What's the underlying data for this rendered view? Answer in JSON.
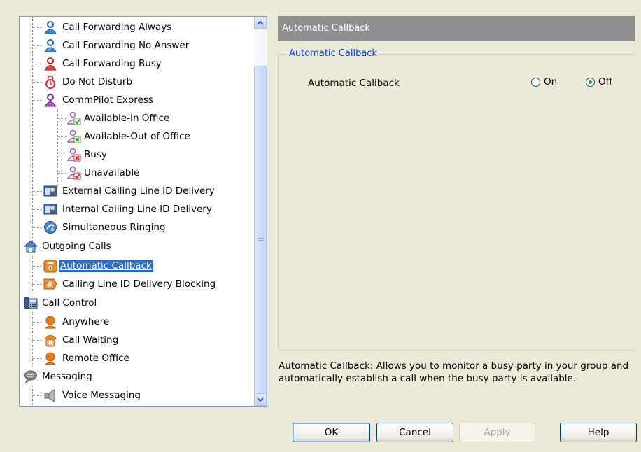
{
  "tree": {
    "items": [
      {
        "label": "Call Forwarding Always",
        "icon": "person-blue-icon"
      },
      {
        "label": "Call Forwarding No Answer",
        "icon": "person-blue-question-icon"
      },
      {
        "label": "Call Forwarding Busy",
        "icon": "person-red-icon"
      },
      {
        "label": "Do Not Disturb",
        "icon": "person-clock-icon"
      },
      {
        "label": "CommPilot Express",
        "icon": "person-purple-icon"
      },
      {
        "label": "Available-In Office",
        "icon": "person-check-icon"
      },
      {
        "label": "Available-Out of Office",
        "icon": "person-cross-green-icon"
      },
      {
        "label": "Busy",
        "icon": "person-cross-red-icon"
      },
      {
        "label": "Unavailable",
        "icon": "person-red-check-icon"
      },
      {
        "label": "External Calling Line ID Delivery",
        "icon": "id-card-icon"
      },
      {
        "label": "Internal Calling Line ID Delivery",
        "icon": "id-card-icon"
      },
      {
        "label": "Simultaneous Ringing",
        "icon": "ringing-globe-icon"
      },
      {
        "label": "Outgoing Calls",
        "icon": "house-icon"
      },
      {
        "label": "Automatic Callback",
        "icon": "phone-callback-icon"
      },
      {
        "label": "Calling Line ID Delivery Blocking",
        "icon": "hash-block-icon"
      },
      {
        "label": "Call Control",
        "icon": "desk-phone-icon"
      },
      {
        "label": "Anywhere",
        "icon": "orange-person-icon"
      },
      {
        "label": "Call Waiting",
        "icon": "phone-waiting-icon"
      },
      {
        "label": "Remote Office",
        "icon": "orange-person-icon"
      },
      {
        "label": "Messaging",
        "icon": "speech-bubble-icon"
      },
      {
        "label": "Voice Messaging",
        "icon": "speaker-icon"
      }
    ]
  },
  "panel": {
    "header": "Automatic Callback",
    "group_title": "Automatic Callback",
    "setting_label": "Automatic Callback",
    "option_on": "On",
    "option_off": "Off",
    "selected": "Off",
    "description": "Automatic Callback: Allows you to monitor a busy party in your group and automatically establish a call when the busy party is available."
  },
  "buttons": {
    "ok": "OK",
    "cancel": "Cancel",
    "apply": "Apply",
    "help": "Help"
  },
  "colors": {
    "selection": "#316ac5",
    "header_bg": "#8f8f8f",
    "group_title": "#0046d5"
  }
}
